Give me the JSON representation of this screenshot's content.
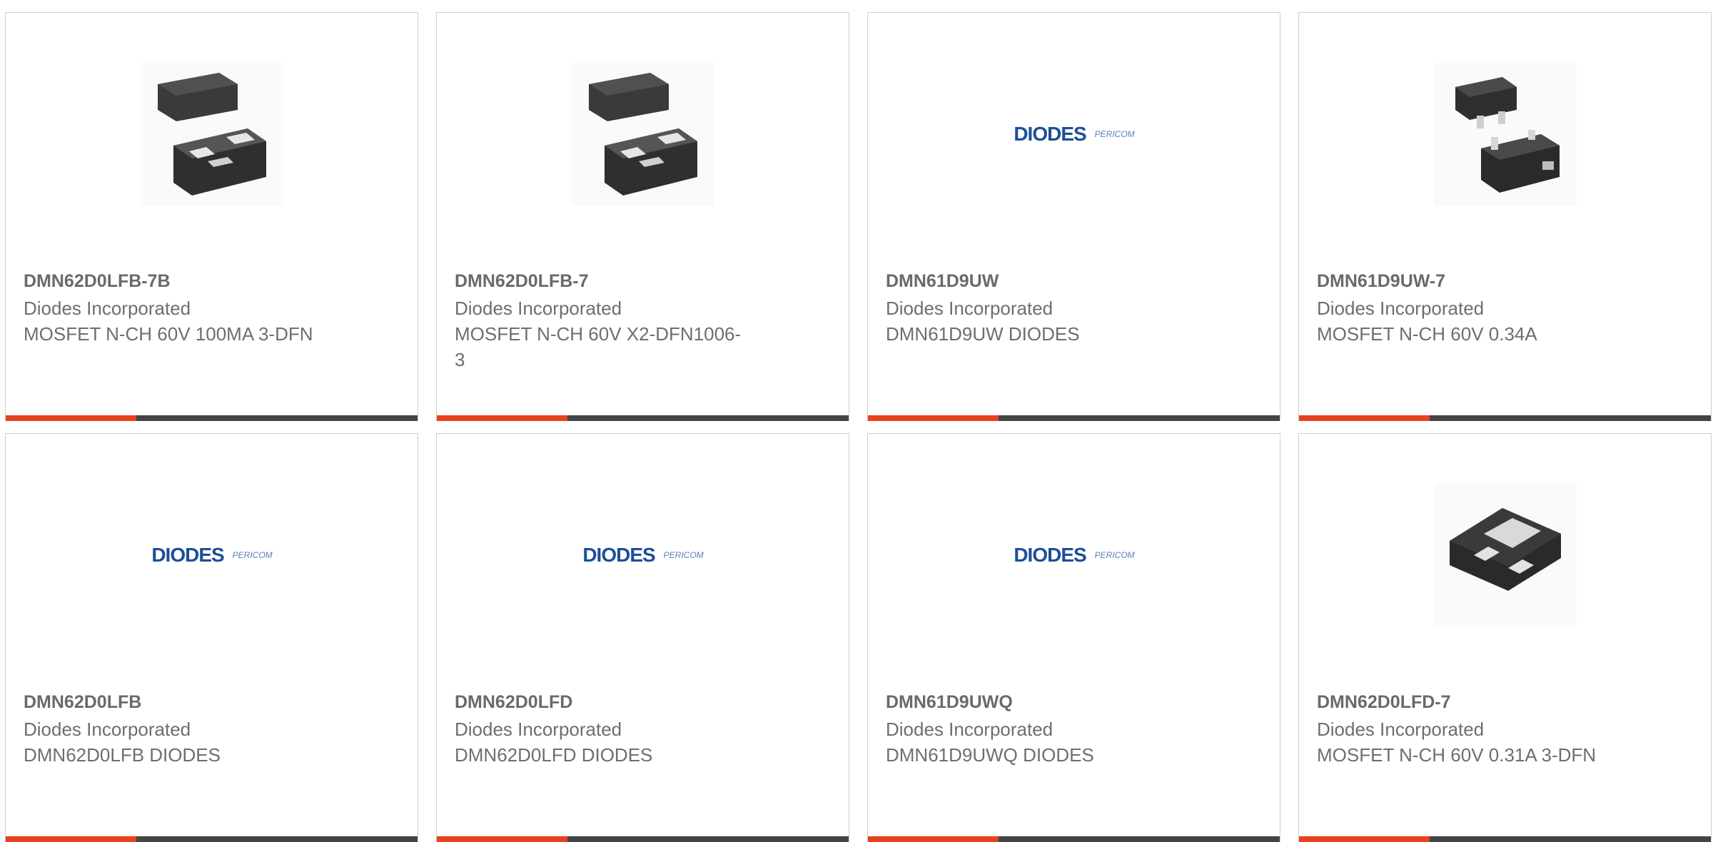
{
  "colors": {
    "accent": "#e8411f",
    "bar": "#444444",
    "text": "#6e6e6e",
    "border": "#cfcfcf",
    "logo": "#1d4f97"
  },
  "products": [
    {
      "part_number": "DMN62D0LFB-7B",
      "manufacturer": "Diodes Incorporated",
      "description": "MOSFET N-CH 60V 100MA 3-DFN",
      "image": "dfn-package-image"
    },
    {
      "part_number": "DMN62D0LFB-7",
      "manufacturer": "Diodes Incorporated",
      "description": "MOSFET N-CH 60V X2-DFN1006-3",
      "image": "dfn-package-image"
    },
    {
      "part_number": "DMN61D9UW",
      "manufacturer": "Diodes Incorporated",
      "description": "DMN61D9UW DIODES",
      "image": "diodes-pericom-logo"
    },
    {
      "part_number": "DMN61D9UW-7",
      "manufacturer": "Diodes Incorporated",
      "description": "MOSFET N-CH 60V 0.34A",
      "image": "sot323-package-image"
    },
    {
      "part_number": "DMN62D0LFB",
      "manufacturer": "Diodes Incorporated",
      "description": "DMN62D0LFB DIODES",
      "image": "diodes-pericom-logo"
    },
    {
      "part_number": "DMN62D0LFD",
      "manufacturer": "Diodes Incorporated",
      "description": "DMN62D0LFD DIODES",
      "image": "diodes-pericom-logo"
    },
    {
      "part_number": "DMN61D9UWQ",
      "manufacturer": "Diodes Incorporated",
      "description": "DMN61D9UWQ DIODES",
      "image": "diodes-pericom-logo"
    },
    {
      "part_number": "DMN62D0LFD-7",
      "manufacturer": "Diodes Incorporated",
      "description": "MOSFET N-CH 60V 0.31A 3-DFN",
      "image": "dfn3-package-image"
    }
  ],
  "logo": {
    "brand": "DIODES",
    "sub": "PERICOM"
  }
}
